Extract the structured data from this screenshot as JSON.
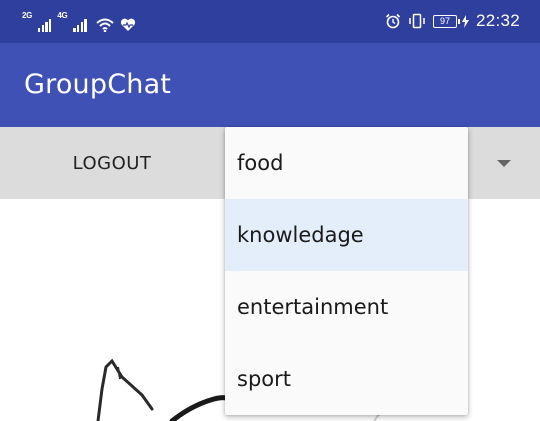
{
  "status_bar": {
    "net1": "2G",
    "net2": "4G",
    "battery": "97",
    "time": "22:32",
    "icons": [
      "signal-icon",
      "wifi-icon",
      "heart-icon",
      "alarm-icon",
      "vibrate-icon",
      "battery-icon",
      "charging-icon"
    ]
  },
  "app_bar": {
    "title": "GroupChat",
    "color": "#3f51b5"
  },
  "toolbar": {
    "logout_label": "LOGOUT"
  },
  "dropdown": {
    "options": [
      "food",
      "knowledage",
      "entertainment",
      "sport"
    ],
    "highlighted_index": 1
  },
  "colors": {
    "status_bar": "#2f3f9e",
    "app_bar": "#3f51b5",
    "toolbar": "#dcdcdc",
    "highlight": "#e3eefa"
  }
}
